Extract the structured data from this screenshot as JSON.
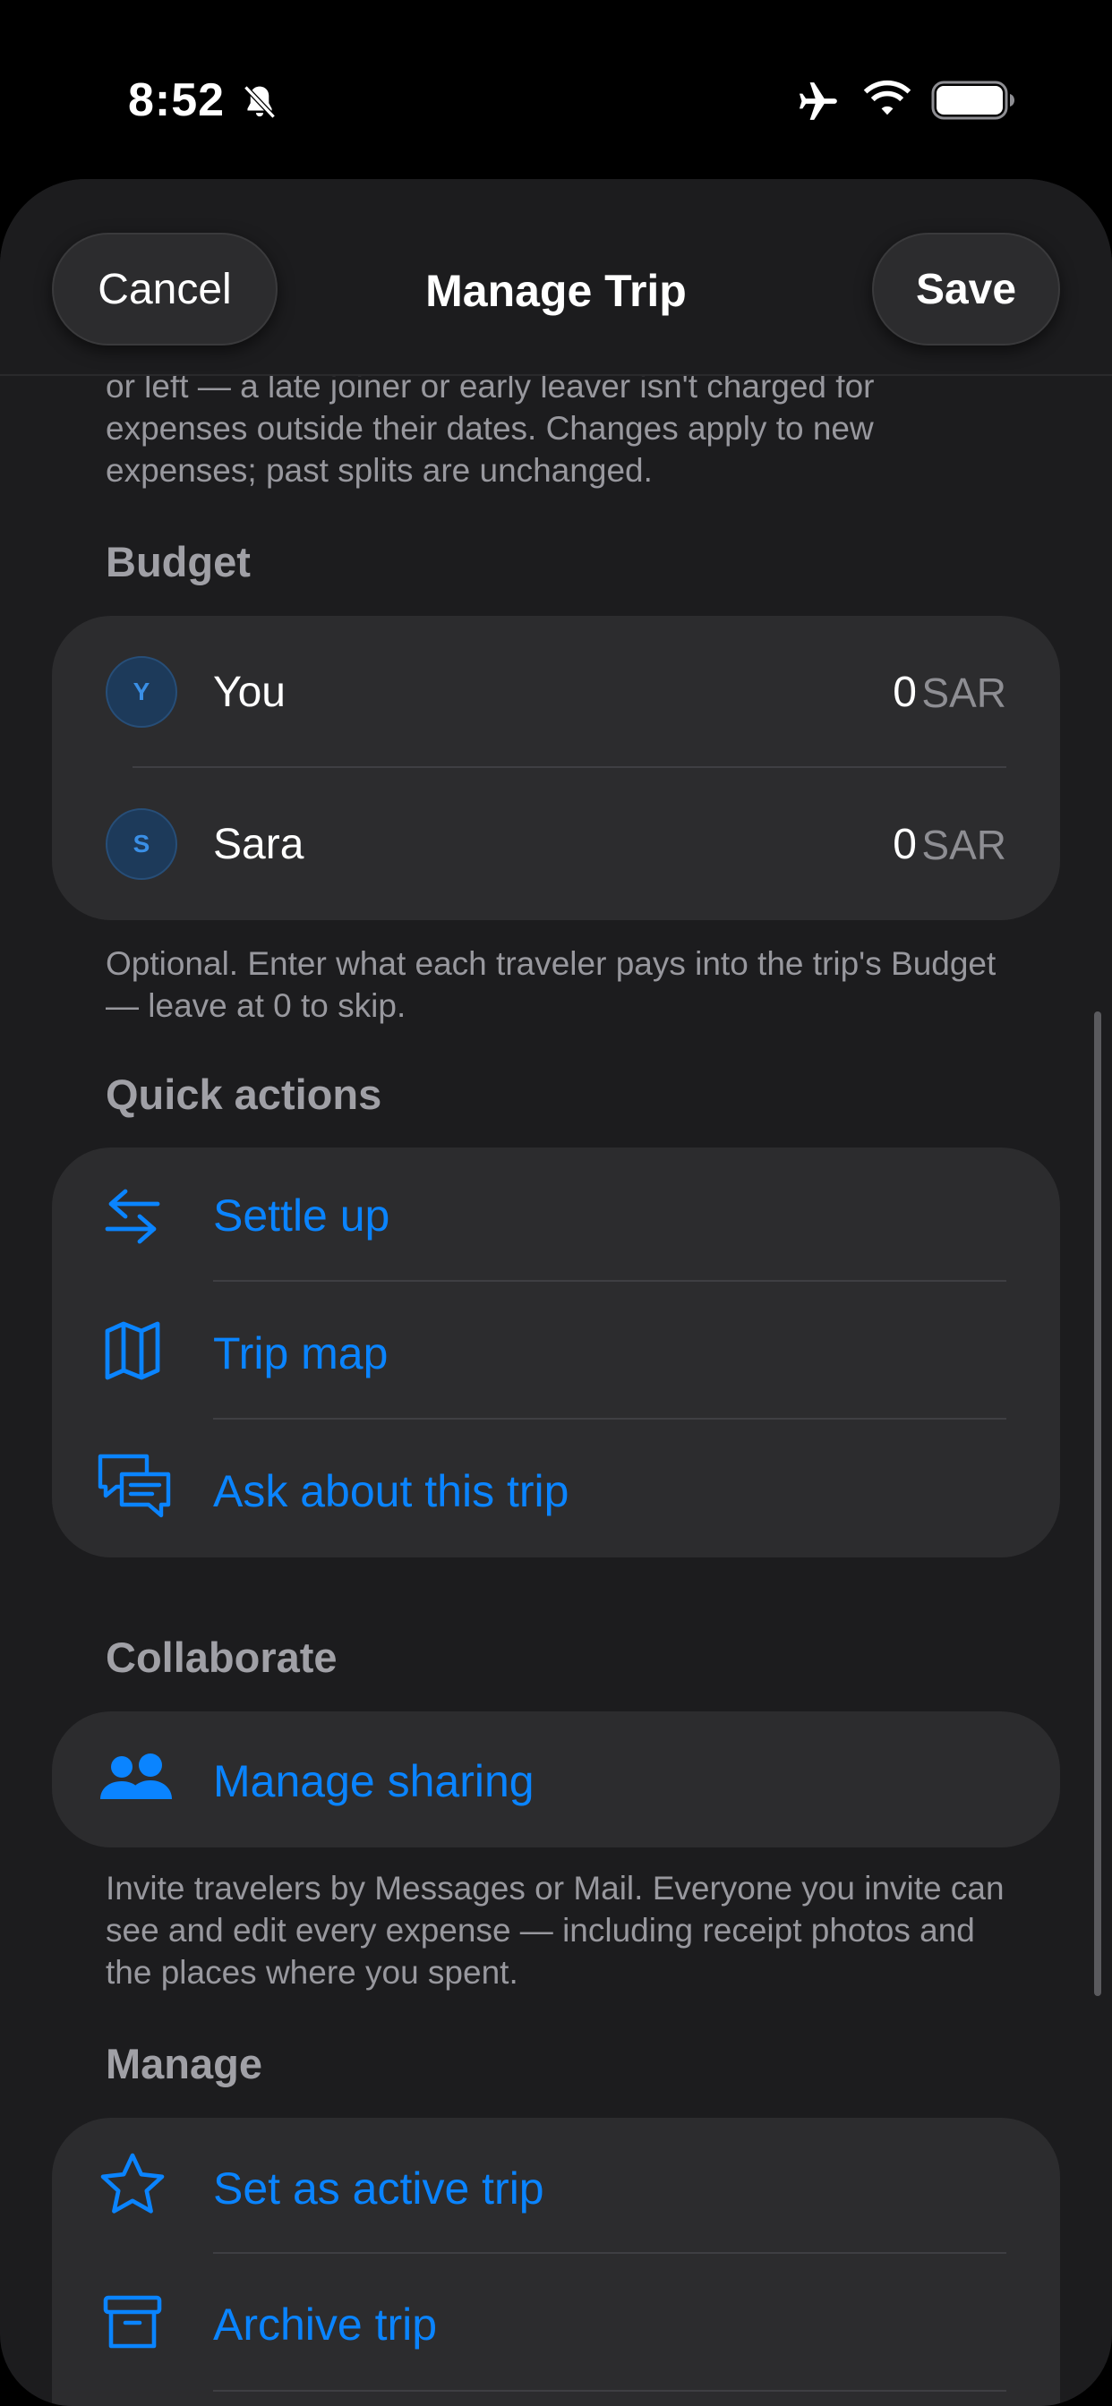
{
  "status_bar": {
    "time": "8:52",
    "icons": [
      "bell-slash-icon",
      "airplane-icon",
      "wifi-icon",
      "battery-icon"
    ]
  },
  "nav": {
    "cancel_label": "Cancel",
    "title": "Manage Trip",
    "save_label": "Save"
  },
  "top_note": "or left — a late joiner or early leaver isn't charged for expenses outside their dates. Changes apply to new expenses; past splits are unchanged.",
  "budget": {
    "header": "Budget",
    "rows": [
      {
        "initial": "Y",
        "name": "You",
        "amount": "0",
        "currency": "SAR"
      },
      {
        "initial": "S",
        "name": "Sara",
        "amount": "0",
        "currency": "SAR"
      }
    ],
    "footer": "Optional. Enter what each traveler pays into the trip's Budget — leave at 0 to skip."
  },
  "quick_actions": {
    "header": "Quick actions",
    "items": [
      {
        "label": "Settle up",
        "icon": "arrows-left-right-icon"
      },
      {
        "label": "Trip map",
        "icon": "map-icon"
      },
      {
        "label": "Ask about this trip",
        "icon": "chat-bubbles-icon"
      }
    ]
  },
  "collaborate": {
    "header": "Collaborate",
    "item_label": "Manage sharing",
    "item_icon": "people-icon",
    "footer": "Invite travelers by Messages or Mail. Everyone you invite can see and edit every expense — including receipt photos and the places where you spent."
  },
  "manage": {
    "header": "Manage",
    "items": [
      {
        "label": "Set as active trip",
        "icon": "star-icon"
      },
      {
        "label": "Archive trip",
        "icon": "archive-box-icon"
      }
    ]
  },
  "colors": {
    "accent": "#0a84ff",
    "background": "#1c1c1e",
    "card": "#2c2c2e",
    "secondary_text": "#98989e"
  }
}
